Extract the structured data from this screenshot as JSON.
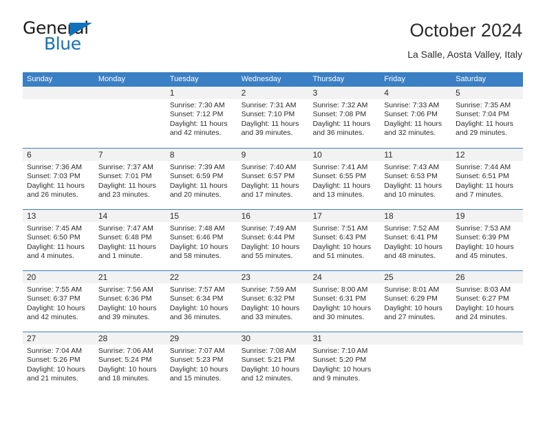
{
  "brand": {
    "name_top": "General",
    "name_bottom": "Blue"
  },
  "header": {
    "title": "October 2024",
    "subtitle": "La Salle, Aosta Valley, Italy"
  },
  "colors": {
    "header_blue": "#3b7fc4",
    "logo_blue": "#1271ba",
    "day_band_gray": "#f2f2f2",
    "text": "#2b2b2b"
  },
  "weekdays": [
    "Sunday",
    "Monday",
    "Tuesday",
    "Wednesday",
    "Thursday",
    "Friday",
    "Saturday"
  ],
  "labels": {
    "sunrise_prefix": "Sunrise:",
    "sunset_prefix": "Sunset:",
    "daylight_prefix": "Daylight:"
  },
  "weeks": [
    [
      {
        "day": "",
        "sunrise": "",
        "sunset": "",
        "daylight_1": "",
        "daylight_2": ""
      },
      {
        "day": "",
        "sunrise": "",
        "sunset": "",
        "daylight_1": "",
        "daylight_2": ""
      },
      {
        "day": "1",
        "sunrise": "Sunrise: 7:30 AM",
        "sunset": "Sunset: 7:12 PM",
        "daylight_1": "Daylight: 11 hours",
        "daylight_2": "and 42 minutes."
      },
      {
        "day": "2",
        "sunrise": "Sunrise: 7:31 AM",
        "sunset": "Sunset: 7:10 PM",
        "daylight_1": "Daylight: 11 hours",
        "daylight_2": "and 39 minutes."
      },
      {
        "day": "3",
        "sunrise": "Sunrise: 7:32 AM",
        "sunset": "Sunset: 7:08 PM",
        "daylight_1": "Daylight: 11 hours",
        "daylight_2": "and 36 minutes."
      },
      {
        "day": "4",
        "sunrise": "Sunrise: 7:33 AM",
        "sunset": "Sunset: 7:06 PM",
        "daylight_1": "Daylight: 11 hours",
        "daylight_2": "and 32 minutes."
      },
      {
        "day": "5",
        "sunrise": "Sunrise: 7:35 AM",
        "sunset": "Sunset: 7:04 PM",
        "daylight_1": "Daylight: 11 hours",
        "daylight_2": "and 29 minutes."
      }
    ],
    [
      {
        "day": "6",
        "sunrise": "Sunrise: 7:36 AM",
        "sunset": "Sunset: 7:03 PM",
        "daylight_1": "Daylight: 11 hours",
        "daylight_2": "and 26 minutes."
      },
      {
        "day": "7",
        "sunrise": "Sunrise: 7:37 AM",
        "sunset": "Sunset: 7:01 PM",
        "daylight_1": "Daylight: 11 hours",
        "daylight_2": "and 23 minutes."
      },
      {
        "day": "8",
        "sunrise": "Sunrise: 7:39 AM",
        "sunset": "Sunset: 6:59 PM",
        "daylight_1": "Daylight: 11 hours",
        "daylight_2": "and 20 minutes."
      },
      {
        "day": "9",
        "sunrise": "Sunrise: 7:40 AM",
        "sunset": "Sunset: 6:57 PM",
        "daylight_1": "Daylight: 11 hours",
        "daylight_2": "and 17 minutes."
      },
      {
        "day": "10",
        "sunrise": "Sunrise: 7:41 AM",
        "sunset": "Sunset: 6:55 PM",
        "daylight_1": "Daylight: 11 hours",
        "daylight_2": "and 13 minutes."
      },
      {
        "day": "11",
        "sunrise": "Sunrise: 7:43 AM",
        "sunset": "Sunset: 6:53 PM",
        "daylight_1": "Daylight: 11 hours",
        "daylight_2": "and 10 minutes."
      },
      {
        "day": "12",
        "sunrise": "Sunrise: 7:44 AM",
        "sunset": "Sunset: 6:51 PM",
        "daylight_1": "Daylight: 11 hours",
        "daylight_2": "and 7 minutes."
      }
    ],
    [
      {
        "day": "13",
        "sunrise": "Sunrise: 7:45 AM",
        "sunset": "Sunset: 6:50 PM",
        "daylight_1": "Daylight: 11 hours",
        "daylight_2": "and 4 minutes."
      },
      {
        "day": "14",
        "sunrise": "Sunrise: 7:47 AM",
        "sunset": "Sunset: 6:48 PM",
        "daylight_1": "Daylight: 11 hours",
        "daylight_2": "and 1 minute."
      },
      {
        "day": "15",
        "sunrise": "Sunrise: 7:48 AM",
        "sunset": "Sunset: 6:46 PM",
        "daylight_1": "Daylight: 10 hours",
        "daylight_2": "and 58 minutes."
      },
      {
        "day": "16",
        "sunrise": "Sunrise: 7:49 AM",
        "sunset": "Sunset: 6:44 PM",
        "daylight_1": "Daylight: 10 hours",
        "daylight_2": "and 55 minutes."
      },
      {
        "day": "17",
        "sunrise": "Sunrise: 7:51 AM",
        "sunset": "Sunset: 6:43 PM",
        "daylight_1": "Daylight: 10 hours",
        "daylight_2": "and 51 minutes."
      },
      {
        "day": "18",
        "sunrise": "Sunrise: 7:52 AM",
        "sunset": "Sunset: 6:41 PM",
        "daylight_1": "Daylight: 10 hours",
        "daylight_2": "and 48 minutes."
      },
      {
        "day": "19",
        "sunrise": "Sunrise: 7:53 AM",
        "sunset": "Sunset: 6:39 PM",
        "daylight_1": "Daylight: 10 hours",
        "daylight_2": "and 45 minutes."
      }
    ],
    [
      {
        "day": "20",
        "sunrise": "Sunrise: 7:55 AM",
        "sunset": "Sunset: 6:37 PM",
        "daylight_1": "Daylight: 10 hours",
        "daylight_2": "and 42 minutes."
      },
      {
        "day": "21",
        "sunrise": "Sunrise: 7:56 AM",
        "sunset": "Sunset: 6:36 PM",
        "daylight_1": "Daylight: 10 hours",
        "daylight_2": "and 39 minutes."
      },
      {
        "day": "22",
        "sunrise": "Sunrise: 7:57 AM",
        "sunset": "Sunset: 6:34 PM",
        "daylight_1": "Daylight: 10 hours",
        "daylight_2": "and 36 minutes."
      },
      {
        "day": "23",
        "sunrise": "Sunrise: 7:59 AM",
        "sunset": "Sunset: 6:32 PM",
        "daylight_1": "Daylight: 10 hours",
        "daylight_2": "and 33 minutes."
      },
      {
        "day": "24",
        "sunrise": "Sunrise: 8:00 AM",
        "sunset": "Sunset: 6:31 PM",
        "daylight_1": "Daylight: 10 hours",
        "daylight_2": "and 30 minutes."
      },
      {
        "day": "25",
        "sunrise": "Sunrise: 8:01 AM",
        "sunset": "Sunset: 6:29 PM",
        "daylight_1": "Daylight: 10 hours",
        "daylight_2": "and 27 minutes."
      },
      {
        "day": "26",
        "sunrise": "Sunrise: 8:03 AM",
        "sunset": "Sunset: 6:27 PM",
        "daylight_1": "Daylight: 10 hours",
        "daylight_2": "and 24 minutes."
      }
    ],
    [
      {
        "day": "27",
        "sunrise": "Sunrise: 7:04 AM",
        "sunset": "Sunset: 5:26 PM",
        "daylight_1": "Daylight: 10 hours",
        "daylight_2": "and 21 minutes."
      },
      {
        "day": "28",
        "sunrise": "Sunrise: 7:06 AM",
        "sunset": "Sunset: 5:24 PM",
        "daylight_1": "Daylight: 10 hours",
        "daylight_2": "and 18 minutes."
      },
      {
        "day": "29",
        "sunrise": "Sunrise: 7:07 AM",
        "sunset": "Sunset: 5:23 PM",
        "daylight_1": "Daylight: 10 hours",
        "daylight_2": "and 15 minutes."
      },
      {
        "day": "30",
        "sunrise": "Sunrise: 7:08 AM",
        "sunset": "Sunset: 5:21 PM",
        "daylight_1": "Daylight: 10 hours",
        "daylight_2": "and 12 minutes."
      },
      {
        "day": "31",
        "sunrise": "Sunrise: 7:10 AM",
        "sunset": "Sunset: 5:20 PM",
        "daylight_1": "Daylight: 10 hours",
        "daylight_2": "and 9 minutes."
      },
      {
        "day": "",
        "sunrise": "",
        "sunset": "",
        "daylight_1": "",
        "daylight_2": ""
      },
      {
        "day": "",
        "sunrise": "",
        "sunset": "",
        "daylight_1": "",
        "daylight_2": ""
      }
    ]
  ]
}
